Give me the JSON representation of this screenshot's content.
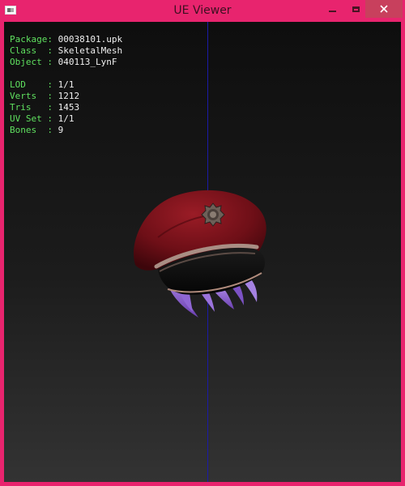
{
  "window": {
    "title": "UE Viewer",
    "accent_color": "#e8246e",
    "icons": [
      "app-icon",
      "minimize-icon",
      "maximize-icon",
      "close-icon"
    ]
  },
  "info": {
    "package": {
      "key": "Package: ",
      "value": "00038101.upk"
    },
    "class": {
      "key": "Class  : ",
      "value": "SkeletalMesh"
    },
    "object": {
      "key": "Object : ",
      "value": "040113_LynF"
    },
    "lod": {
      "key": "LOD    : ",
      "value": "1/1"
    },
    "verts": {
      "key": "Verts  : ",
      "value": "1212"
    },
    "tris": {
      "key": "Tris   : ",
      "value": "1453"
    },
    "uvset": {
      "key": "UV Set : ",
      "value": "1/1"
    },
    "bones": {
      "key": "Bones  : ",
      "value": "9"
    }
  },
  "colors": {
    "label": "#5fe05f",
    "value": "#f0f0f0",
    "axis": "#1a1aa8"
  }
}
